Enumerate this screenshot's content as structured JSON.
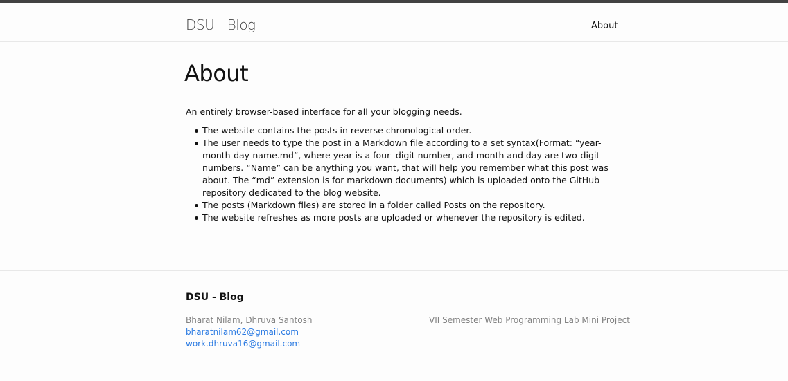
{
  "header": {
    "site_title": "DSU - Blog",
    "nav": [
      {
        "label": "About"
      }
    ]
  },
  "main": {
    "title": "About",
    "intro": "An entirely browser-based interface for all your blogging needs.",
    "bullets": [
      "The website contains the posts in reverse chronological order.",
      "The user needs to type the post in a Markdown file according to a set syntax(Format: “year-month-day-name.md”, where year is a four- digit number, and month and day are two-digit numbers. “Name” can be anything you want, that will help you remember what this post was about. The “md” extension is for markdown documents) which is uploaded onto the GitHub repository dedicated to the blog website.",
      "The posts (Markdown files) are stored in a folder called Posts on the repository.",
      "The website refreshes as more posts are uploaded or whenever the repository is edited."
    ]
  },
  "footer": {
    "title": "DSU - Blog",
    "authors": "Bharat Nilam, Dhruva Santosh",
    "emails": [
      "bharatnilam62@gmail.com",
      "work.dhruva16@gmail.com"
    ],
    "description": "VII Semester Web Programming Lab Mini Project"
  },
  "colors": {
    "top_bar": "#424242",
    "link": "#2a7ae2",
    "muted_text": "#828282",
    "border": "#e8e8e8"
  }
}
